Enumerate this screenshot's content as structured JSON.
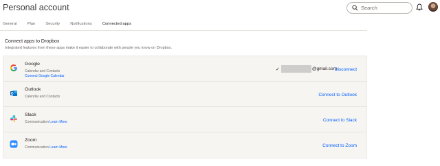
{
  "header": {
    "title": "Personal account",
    "search_placeholder": "Search"
  },
  "tabs": [
    {
      "label": "General",
      "active": false
    },
    {
      "label": "Plan",
      "active": false
    },
    {
      "label": "Security",
      "active": false
    },
    {
      "label": "Notifications",
      "active": false
    },
    {
      "label": "Connected apps",
      "active": true
    }
  ],
  "section": {
    "title": "Connect apps to Dropbox",
    "description": "Integrated features from these apps make it easier to collaborate with people you know on Dropbox."
  },
  "apps": [
    {
      "name": "Google",
      "subtitle": "Calendar and Contacts",
      "secondary_link": "Connect Google Calendar",
      "account_suffix": "@gmail.com",
      "action": "Disconnect",
      "icon": "google-icon"
    },
    {
      "name": "Outlook",
      "subtitle": "Calendar and Contacts",
      "action": "Connect to Outlook",
      "icon": "outlook-icon"
    },
    {
      "name": "Slack",
      "subtitle": "Communication",
      "learn_more": "Learn More",
      "action": "Connect to Slack",
      "icon": "slack-icon"
    },
    {
      "name": "Zoom",
      "subtitle": "Communication",
      "learn_more": "Learn More",
      "action": "Connect to Zoom",
      "icon": "zoom-icon"
    }
  ],
  "colors": {
    "link": "#0061fe",
    "panel_bg": "#f7f5f2",
    "text": "#1e1919",
    "muted": "#6b6865"
  }
}
